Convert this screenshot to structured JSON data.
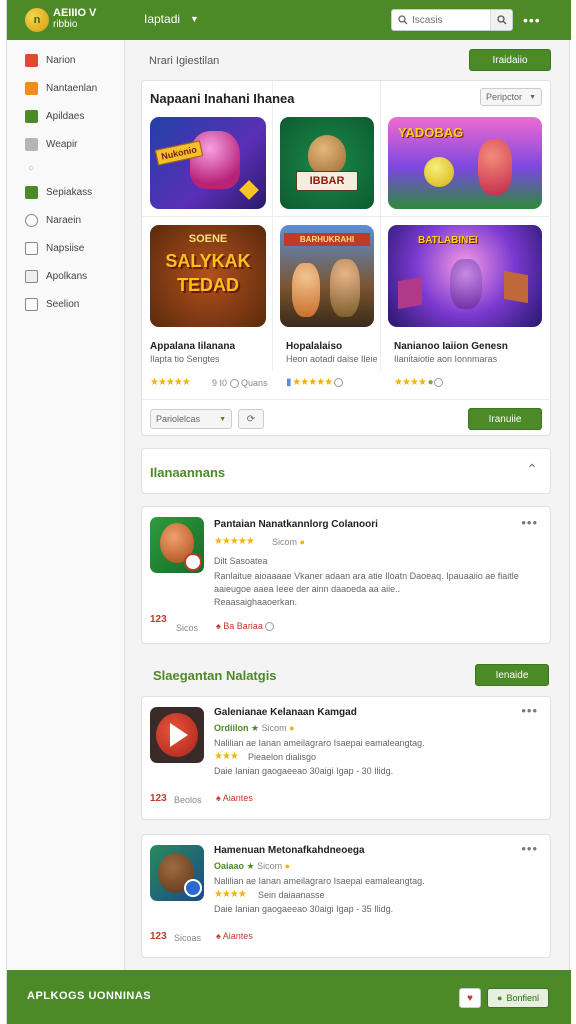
{
  "header": {
    "brand_line1": "AEIIIO V",
    "brand_line2": "ribbio",
    "logo_text": "n",
    "nav_label": "Iaptadi",
    "search_placeholder": "Iscasis"
  },
  "sidebar": {
    "items": [
      {
        "label": "Narion",
        "icon": "target-icon",
        "color": "#e04a2e"
      },
      {
        "label": "Nantaenlan",
        "icon": "grid-icon",
        "color": "#f08c1a"
      },
      {
        "label": "Apildaes",
        "icon": "chart-icon",
        "color": "#4b8a27"
      },
      {
        "label": "Weapir",
        "icon": "puzzle-icon",
        "color": "#999999"
      },
      {
        "label": "Sepiakass",
        "icon": "check-square-icon",
        "color": "#4b8a27"
      },
      {
        "label": "Naraein",
        "icon": "globe-icon",
        "color": "#888888"
      },
      {
        "label": "Napsiise",
        "icon": "tag-icon",
        "color": "#888888"
      },
      {
        "label": "Apolkans",
        "icon": "image-icon",
        "color": "#888888"
      },
      {
        "label": "Seelion",
        "icon": "list-icon",
        "color": "#888888"
      }
    ]
  },
  "main": {
    "breadcrumb": "Nrari Igiestilan",
    "top_button": "Iraidaiio",
    "featured": {
      "title": "Napaani Inahani Ihanea",
      "sort_label": "Peripctor",
      "games": [
        {
          "name": "Appalana Iilanana",
          "dev": "Ilapta tio Sengtes",
          "rating_text": "9 I0",
          "extra": "Quans"
        },
        {
          "name": "Hopalalaiso",
          "dev": "Heon aotadi daise Ileie",
          "rating_text": "",
          "extra": ""
        },
        {
          "name": "Nanianoo Iaiion Genesn",
          "dev": "Ilanitaiotie aon Ionnmaras",
          "rating_text": "",
          "extra": ""
        }
      ],
      "tile_texts": {
        "t1": "Nukonio",
        "t2": "IBBAR",
        "t3": "YADOBAG",
        "t4_line1": "SOENE",
        "t4_line2": "SALYKAK",
        "t4_line3": "TEDAD",
        "t5": "BARHUKRAHI",
        "t6": "BATLABINEI"
      },
      "filter_label": "Pariolelcas",
      "bottom_button": "Iranuiie"
    },
    "section1": {
      "title": "Ilanaannans"
    },
    "review1": {
      "name": "Pantaian Nanatkannlorg Colanoori",
      "rating_text": "Sicom",
      "subtitle": "Dilt Sasoatea",
      "body": "Ranlaitue aioaaaae Vkaner adaan ara atie Iloatn Daoeaq. Ipauaaiio ae fiaitle aaieugoe aaea Ieee der ainn daaoeda aa aiie..",
      "body2": "Reaasaighaaoerkan.",
      "count": "123",
      "count_label": "Sicos",
      "action": "Ba Bariaa"
    },
    "section2": {
      "title": "Slaegantan Nalatgis",
      "button": "Ienaide"
    },
    "review2": {
      "name": "Galenianae Kelanaan Kamgad",
      "tag": "Ordiilon",
      "rating_text": "Sicom",
      "line1": "Nalilian ae Ianan ameilagraro Isaepai eamaleangtag.",
      "line2": "Pieaelon dialisgo",
      "line3": "Daie Ianian gaogaeeao 30aigi Igap - 30 Ilidg.",
      "count": "123",
      "count_label": "Beolos",
      "action": "Aiantes"
    },
    "review3": {
      "name": "Hamenuan Metonafkahdneoega",
      "tag": "Oaiaao",
      "rating_text": "Sicom",
      "line1": "Nalilian ae Ianan ameilagraro Isaepai eamaleangtag.",
      "line2": "Sein daiaanasse",
      "line3": "Daie Ianian gaogaeeao 30aigi Igap - 35 Ilidg.",
      "count": "123",
      "count_label": "Sicoas",
      "action": "Aiantes"
    }
  },
  "footer": {
    "text": "APLKOGS UONNINAS",
    "button": "Bonfienl"
  },
  "colors": {
    "accent": "#4b8a27",
    "star": "#f1b50a"
  }
}
